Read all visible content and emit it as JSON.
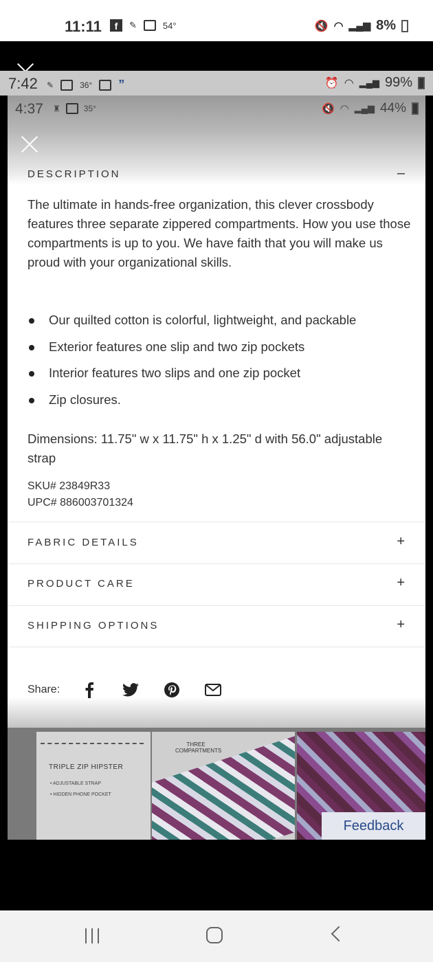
{
  "status_outer": {
    "time": "11:11",
    "temp": "54°",
    "battery": "8%"
  },
  "status_inner1": {
    "time": "7:42",
    "temp": "36°",
    "battery": "99%"
  },
  "status_inner2": {
    "time": "4:37",
    "temp": "35°",
    "battery": "44%"
  },
  "description": {
    "heading": "DESCRIPTION",
    "toggle": "–",
    "text": "The ultimate in hands-free organization, this clever crossbody features three separate zippered compartments. How you use those compartments is up to you. We have faith that you will make us proud with your organizational skills.",
    "bullets": [
      "Our quilted cotton is colorful, lightweight, and packable",
      "Exterior features one slip and two zip pockets",
      "Interior features two slips and one zip pocket",
      "Zip closures."
    ],
    "dimensions": "Dimensions: 11.75\" w x 11.75\" h x 1.25\" d with 56.0\" adjustable strap",
    "sku": "SKU# 23849R33",
    "upc": "UPC# 886003701324"
  },
  "sections": [
    {
      "label": "FABRIC DETAILS",
      "toggle": "+"
    },
    {
      "label": "PRODUCT CARE",
      "toggle": "+"
    },
    {
      "label": "SHIPPING OPTIONS",
      "toggle": "+"
    }
  ],
  "share": {
    "label": "Share:",
    "icons": [
      "facebook-icon",
      "twitter-icon",
      "pinterest-icon",
      "email-icon"
    ]
  },
  "product_images": {
    "image1_title": "TRIPLE ZIP HIPSTER",
    "image1_bullet1": "• ADJUSTABLE STRAP",
    "image1_bullet2": "• HIDDEN PHONE POCKET",
    "image2_label": "THREE COMPARTMENTS"
  },
  "feedback_label": "Feedback"
}
